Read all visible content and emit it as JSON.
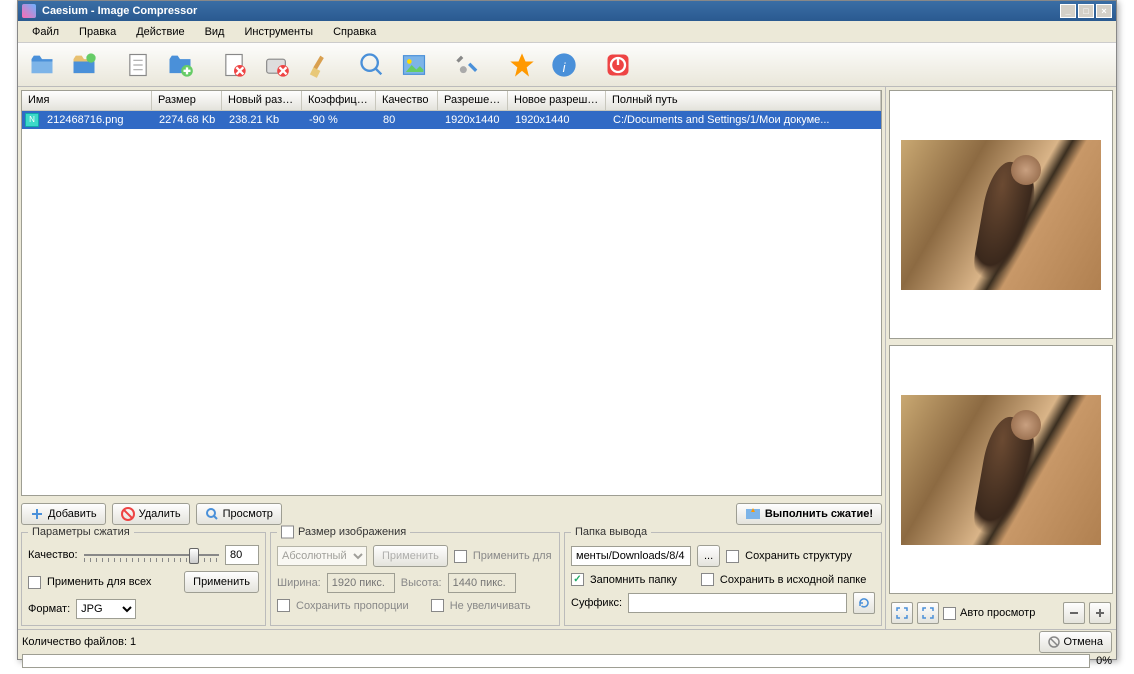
{
  "title": "Caesium - Image Compressor",
  "menubar": [
    "Файл",
    "Правка",
    "Действие",
    "Вид",
    "Инструменты",
    "Справка"
  ],
  "toolbar_icons": [
    "open-file-icon",
    "open-folder-icon",
    "sep",
    "add-doc-icon",
    "add-folder-icon",
    "sep",
    "remove-doc-icon",
    "remove-folder-icon",
    "broom-icon",
    "sep",
    "magnifier-icon",
    "image-icon",
    "sep",
    "tools-icon",
    "sep",
    "star-icon",
    "info-icon",
    "sep",
    "power-icon"
  ],
  "columns": [
    "Имя",
    "Размер",
    "Новый размер",
    "Коэффициент",
    "Качество",
    "Разрешение",
    "Новое разрешение",
    "Полный путь"
  ],
  "rows": [
    {
      "name": "212468716.png",
      "size": "2274.68 Kb",
      "newsize": "238.21 Kb",
      "ratio": "-90 %",
      "quality": "80",
      "res": "1920x1440",
      "newres": "1920x1440",
      "path": "C:/Documents and Settings/1/Мои докуме..."
    }
  ],
  "actions": {
    "add": "Добавить",
    "remove": "Удалить",
    "preview": "Просмотр",
    "compress": "Выполнить сжатие!"
  },
  "compression": {
    "title": "Параметры сжатия",
    "quality_label": "Качество:",
    "quality_value": "80",
    "apply_all": "Применить для всех",
    "apply": "Применить",
    "format_label": "Формат:",
    "format_value": "JPG"
  },
  "resize": {
    "title": "Размер изображения",
    "mode": "Абсолютный",
    "apply": "Применить",
    "apply_for": "Применить для",
    "width_label": "Ширина:",
    "width_placeholder": "1920 пикс.",
    "height_label": "Высота:",
    "height_placeholder": "1440 пикс.",
    "keep_ratio": "Сохранить пропорции",
    "no_enlarge": "Не увеличивать"
  },
  "output": {
    "title": "Папка вывода",
    "path": "менты/Downloads/8/4",
    "browse": "...",
    "keep_structure": "Сохранить структуру",
    "remember": "Запомнить папку",
    "save_source": "Сохранить в исходной папке",
    "suffix_label": "Суффикс:",
    "suffix_value": ""
  },
  "status": {
    "file_count_label": "Количество файлов: 1",
    "cancel": "Отмена",
    "progress_pct": "0%"
  },
  "preview_controls": {
    "auto_preview": "Авто просмотр"
  }
}
